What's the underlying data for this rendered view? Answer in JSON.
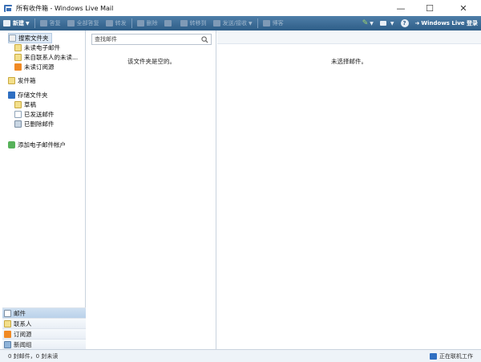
{
  "window": {
    "title": "所有收件箱 - Windows Live Mail",
    "minimize": "—",
    "maximize": "☐",
    "close": "✕"
  },
  "toolbar": {
    "new": "新建",
    "reply": "答复",
    "reply_all": "全部答复",
    "forward": "转发",
    "delete": "删除",
    "move_to": "转移到",
    "send_receive": "发送/接收",
    "blog": "博客",
    "sign_in": "Windows Live 登录",
    "help": "?"
  },
  "folders": {
    "search_folders": "搜索文件夹",
    "unread_email": "未读电子邮件",
    "unread_from_contacts": "来自联系人的未读...",
    "unread_feeds": "未读订阅源",
    "outbox": "发件箱",
    "storage_folders": "存储文件夹",
    "drafts": "草稿",
    "sent_items": "已发送邮件",
    "deleted_items": "已删除邮件",
    "add_account": "添加电子邮件帐户"
  },
  "nav": {
    "mail": "邮件",
    "contacts": "联系人",
    "feeds": "订阅源",
    "newsgroups": "新闻组"
  },
  "message_list": {
    "search_placeholder": "查找邮件",
    "empty_text": "该文件夹是空的。"
  },
  "reading_pane": {
    "empty_text": "未选择邮件。"
  },
  "status": {
    "counts": "0 封邮件，0 封未读",
    "state": "正在联机工作"
  },
  "colors": {
    "toolbar_top": "#4f7fa9",
    "toolbar_bottom": "#2e5d87",
    "selection": "#dce8f5"
  }
}
